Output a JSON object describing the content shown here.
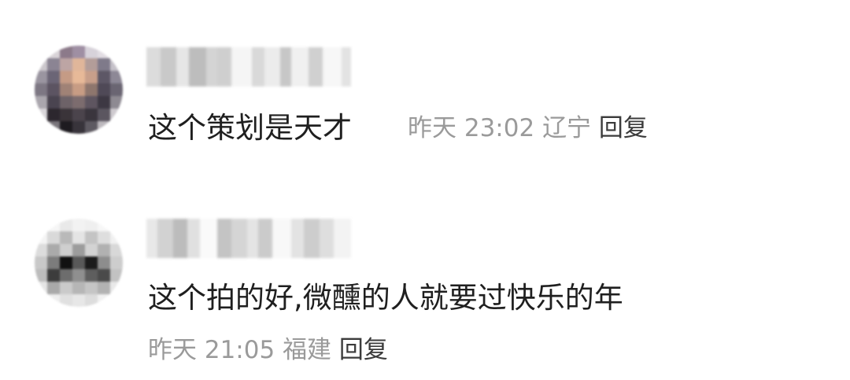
{
  "comments": [
    {
      "text": "这个策划是天才",
      "date": "昨天",
      "time": "23:02",
      "location": "辽宁",
      "reply_label": "回复"
    },
    {
      "text": "这个拍的好,微醺的人就要过快乐的年",
      "date": "昨天",
      "time": "21:05",
      "location": "福建",
      "reply_label": "回复"
    }
  ],
  "colors": {
    "comment_text": "#1f1f1f",
    "meta_text": "#9a9a9a",
    "reply_text": "#3b3b3b",
    "background": "#ffffff"
  },
  "icons": {
    "avatar_1": "pixelated-avatar",
    "avatar_2": "pixelated-avatar"
  }
}
